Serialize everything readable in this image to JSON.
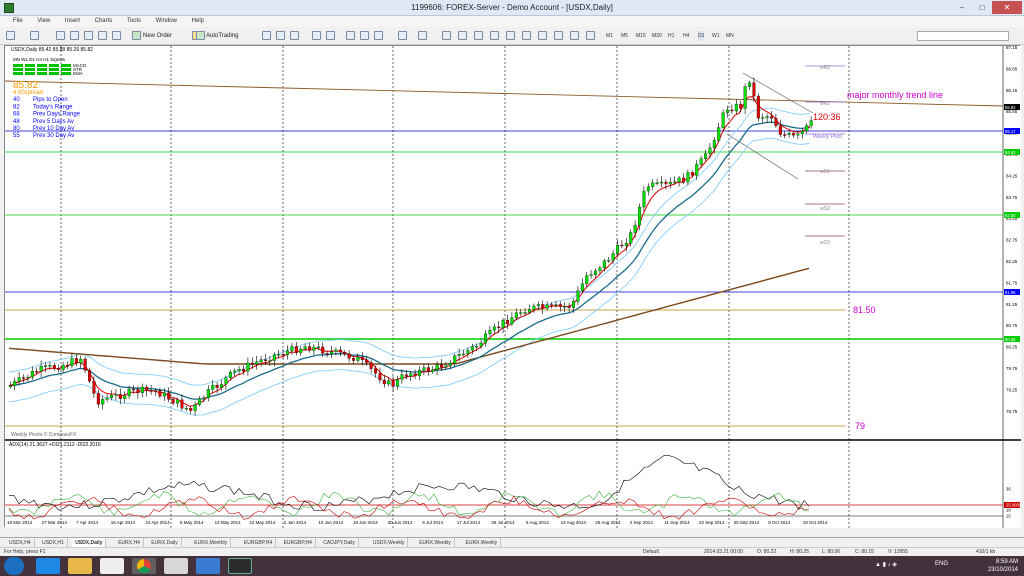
{
  "window": {
    "title": "1199606: FOREX-Server - Demo Account - [USDX,Daily]"
  },
  "menu": [
    "File",
    "View",
    "Insert",
    "Charts",
    "Tools",
    "Window",
    "Help"
  ],
  "toolbar": {
    "new_order": "New Order",
    "autotrading": "AutoTrading",
    "timeframes": [
      "M1",
      "M5",
      "M15",
      "M30",
      "H1",
      "H4",
      "D1",
      "W1",
      "MN"
    ]
  },
  "chart": {
    "symbol_info": "USDX,Daily  85.42 85.88 85.26 85.82",
    "signals_header": "MN  W1  D1  H4  H1  Signals",
    "signal_rows": [
      "MACD",
      "STR",
      "EMA"
    ],
    "big_price": "85.82",
    "stats": [
      {
        "value": "4.00spread",
        "label": "Spread",
        "color": "#ff9900"
      },
      {
        "value": "40",
        "label": "Pips to Open",
        "color": "#0000ff"
      },
      {
        "value": "82",
        "label": "Today's Range",
        "color": "#0000ff"
      },
      {
        "value": "68",
        "label": "Prev Days Range",
        "color": "#0000ff"
      },
      {
        "value": "48",
        "label": "Prev 5 Days Av",
        "color": "#0000ff"
      },
      {
        "value": "80",
        "label": "Prev 10 Day Av",
        "color": "#0000ff"
      },
      {
        "value": "55",
        "label": "Prev 30 Day Av",
        "color": "#0000ff"
      }
    ],
    "annotations": {
      "trend_line": "major monthly trend line",
      "countdown": "120:36",
      "level_81": "81.50",
      "level_79": "79",
      "weekly_pivot": "Weekly Pivot",
      "footer_credit": "Weekly Pivots © CompassFX"
    },
    "pivot_labels": [
      "wR2",
      "wR1",
      "wS1",
      "wS2",
      "wS3"
    ],
    "price_ticks": [
      "87.15",
      "86.65",
      "86.15",
      "85.65",
      "85.15",
      "84.75",
      "84.25",
      "83.75",
      "83.25",
      "82.75",
      "82.25",
      "81.75",
      "81.25",
      "80.75",
      "80.25",
      "79.75",
      "79.25",
      "78.75"
    ],
    "price_badges": [
      {
        "label": "85.82",
        "color": "#000000"
      },
      {
        "label": "85.17",
        "color": "#0000ff"
      },
      {
        "label": "84.83",
        "color": "#00cc00"
      },
      {
        "label": "83.50",
        "color": "#00cc00"
      },
      {
        "label": "81.95",
        "color": "#0000ff"
      },
      {
        "label": "80.65",
        "color": "#00cc00"
      }
    ],
    "date_ticks": [
      "18 Mar 2014",
      "27 Mar 2014",
      "7 Apr 2014",
      "15 Apr 2014",
      "24 Apr 2014",
      "5 May 2014",
      "13 May 2014",
      "22 May 2014",
      "2 Jun 2014",
      "10 Jun 2014",
      "19 Jun 2014",
      "30 Jun 2014",
      "9 Jul 2014",
      "17 Jul 2014",
      "28 Jul 2014",
      "5 Aug 2014",
      "14 Aug 2014",
      "25 Aug 2014",
      "2 Sep 2014",
      "11 Sep 2014",
      "22 Sep 2014",
      "30 Sep 2014",
      "9 Oct 2014",
      "19 Oct 2014"
    ],
    "adx_header": "ADX(14) 21.3627 +DI21.2112 -DI22.2016",
    "adx_ticks": [
      "36",
      "25.0000",
      "18",
      "10"
    ]
  },
  "tabs": [
    "USDX,H4",
    "USDX,H1",
    "USDX,Daily",
    "EURX,H4",
    "EURX,Daily",
    "EURX,Monthly",
    "EURGBP,H4",
    "EURGBP,H4",
    "CADJPY,Daily",
    "USDX,Weekly",
    "EURX,Weekly",
    "EURX,Weekly"
  ],
  "active_tab_index": 2,
  "status": {
    "help": "For Help, press F1",
    "profile": "Default",
    "datetime": "2014.03.21 00:00",
    "open": "O: 80.22",
    "high": "H: 80.25",
    "low": "L: 80.06",
    "close": "C: 80.15",
    "volume": "V: 13955",
    "traffic": "410/1 kb"
  },
  "taskbar": {
    "lang": "ENG",
    "time": "8:59 AM",
    "date": "23/10/2014"
  }
}
